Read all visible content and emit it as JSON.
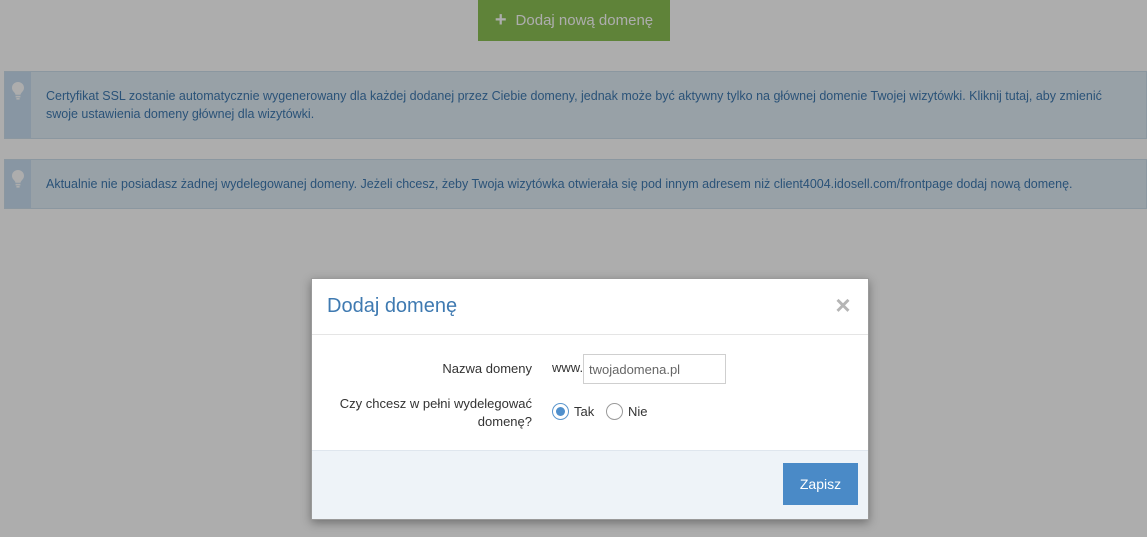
{
  "page": {
    "add_domain_button": "Dodaj nową domenę",
    "ssl_info": "Certyfikat SSL zostanie automatycznie wygenerowany dla każdej dodanej przez Ciebie domeny, jednak może być aktywny tylko na głównej domenie Twojej wizytówki. Kliknij tutaj, aby zmienić swoje ustawienia domeny głównej dla wizytówki.",
    "delegation_info": "Aktualnie nie posiadasz żadnej wydelegowanej domeny. Jeżeli chcesz, żeby Twoja wizytówka otwierała się pod innym adresem niż client4004.idosell.com/frontpage dodaj nową domenę."
  },
  "modal": {
    "title": "Dodaj domenę",
    "close_glyph": "×",
    "domain_label": "Nazwa domeny",
    "www_prefix": "www.",
    "domain_placeholder": "twojadomena.pl",
    "domain_value": "",
    "delegate_label": "Czy chcesz w pełni wydelegować domenę?",
    "options": [
      "Tak",
      "Nie"
    ],
    "selected_option": "Tak",
    "save_label": "Zapisz"
  },
  "colors": {
    "accent_green": "#8cc154",
    "info_text": "#3f7ab1",
    "primary_blue": "#4a8ac7",
    "icons": {
      "plus": "plus-icon",
      "lightbulb": "lightbulb-icon",
      "close": "close-icon"
    }
  }
}
